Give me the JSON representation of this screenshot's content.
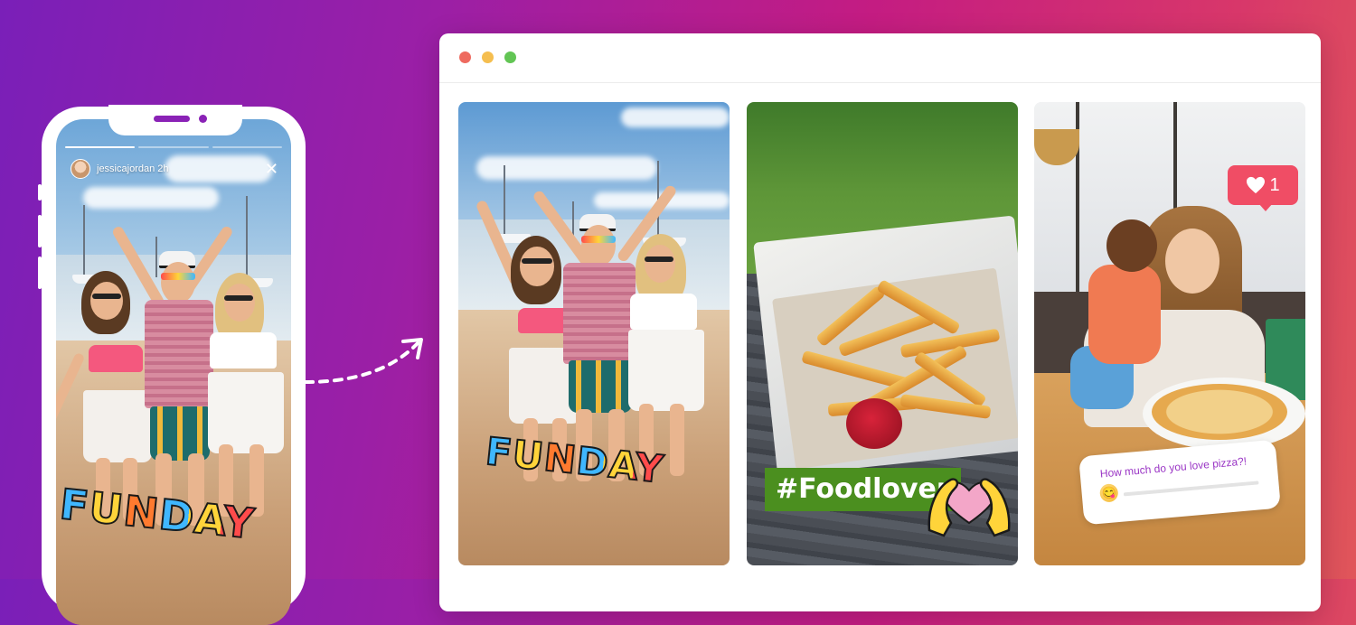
{
  "phone": {
    "story_username": "jessicajordan 2h",
    "close_glyph": "✕",
    "progress": [
      1.0,
      0.0,
      0.0
    ],
    "sticker_text": "FUNDAY"
  },
  "browser": {
    "cards": [
      {
        "sticker_text": "FUNDAY"
      },
      {
        "hashtag": "#Foodlover"
      },
      {
        "like_count": "1",
        "poll_question": "How much do you love pizza?!",
        "poll_emoji": "😋"
      }
    ]
  },
  "colors": {
    "window_red": "#ee6a5f",
    "window_yellow": "#f5be4f",
    "window_green": "#62c554",
    "like_badge": "#f04d65",
    "hashtag_bg": "#4b8f1f",
    "poll_text": "#9a35c5"
  },
  "icons": [
    "close-icon",
    "heart-icon",
    "dashed-arrow-icon",
    "heart-hands-icon"
  ]
}
